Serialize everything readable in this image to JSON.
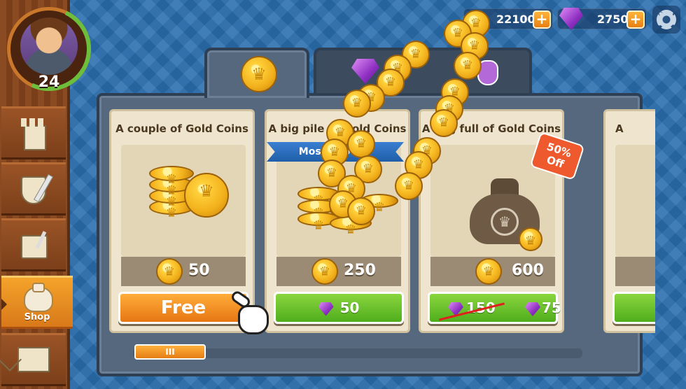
{
  "player": {
    "level": "24"
  },
  "resources": {
    "gold": "22100",
    "gems": "2750",
    "plus_label": "+"
  },
  "sidebar": {
    "items": [
      {
        "label": "",
        "icon": "tower-icon"
      },
      {
        "label": "",
        "icon": "shield-sword-icon"
      },
      {
        "label": "",
        "icon": "scroll-quill-icon"
      },
      {
        "label": "Shop",
        "icon": "bag-icon",
        "active": true
      },
      {
        "label": "",
        "icon": "mail-icon"
      }
    ]
  },
  "shop": {
    "tabs": [
      {
        "icon": "gold-coin-icon",
        "active": true
      },
      {
        "icon": "gem-icon",
        "active": false
      },
      {
        "icon": "potion-icon",
        "active": false
      }
    ],
    "cards": [
      {
        "title": "A couple of Gold Coins",
        "amount": "50",
        "button": {
          "label": "Free",
          "style": "orange"
        }
      },
      {
        "title": "A big pile of Gold Coins",
        "ribbon": "Most Popular",
        "amount": "250",
        "button": {
          "label": "50",
          "style": "green",
          "currency": "gem"
        }
      },
      {
        "title": "A bag full of Gold Coins",
        "badge_line1": "50%",
        "badge_line2": "Off",
        "amount": "600",
        "button": {
          "old_price": "150",
          "label": "75",
          "style": "green",
          "currency": "gem"
        }
      },
      {
        "title": "A"
      }
    ],
    "scrollbar": {
      "thumb_label": "III"
    }
  },
  "colors": {
    "orange": "#e77612",
    "green": "#4fae1c",
    "panel": "#56687d",
    "gem": "#8e2fc2",
    "gold": "#ffd23d"
  }
}
